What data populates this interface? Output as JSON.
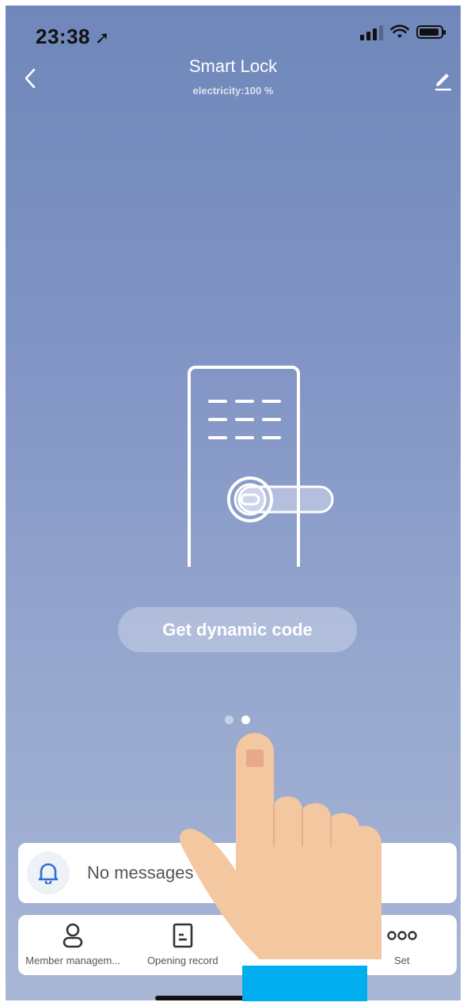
{
  "status_bar": {
    "time": "23:38"
  },
  "header": {
    "title": "Smart Lock",
    "subtitle": "electricity:100 %"
  },
  "main": {
    "dynamic_code_button": "Get dynamic code",
    "pager": {
      "total": 2,
      "active": 2
    }
  },
  "messages": {
    "text": "No messages"
  },
  "tabs": [
    {
      "label": "Member managem..."
    },
    {
      "label": "Opening record"
    },
    {
      "label": ""
    },
    {
      "label": "Set"
    }
  ],
  "colors": {
    "accent": "#2f6fd6",
    "background_top": "#6f87ba",
    "background_bottom": "#a8b6d6"
  }
}
